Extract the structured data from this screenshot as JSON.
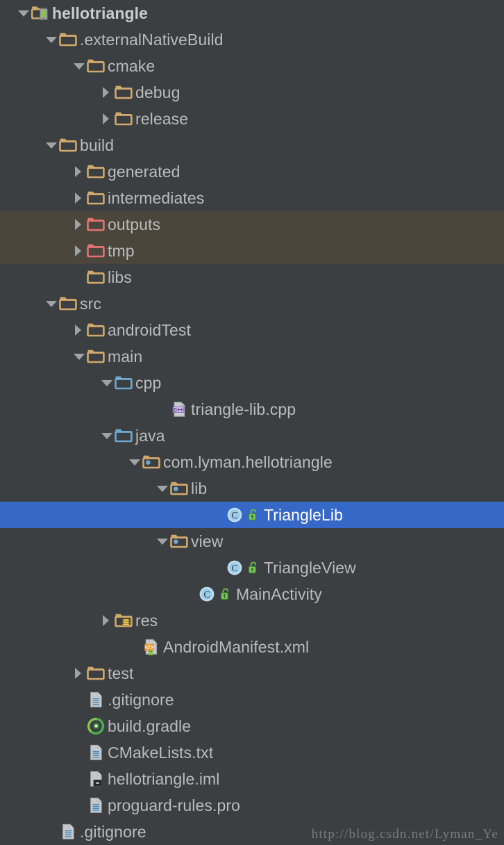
{
  "theme": {
    "background": "#3c3f41",
    "text": "#bbbbbb",
    "selected_background": "#3668c8",
    "selected_text": "#ffffff",
    "highlight_background": "#4a463c",
    "folder_tan": "#d0a96c",
    "folder_red": "#e57373",
    "folder_blue": "#6fa8d0",
    "arrow": "#a0a3a5"
  },
  "watermark": "http://blog.csdn.net/Lyman_Ye",
  "tree": {
    "name": "project-tree",
    "rows": [
      {
        "label": "hellotriangle",
        "icon": "module-android-icon",
        "twisty": "down",
        "depth": 0,
        "bold": true,
        "state": "normal"
      },
      {
        "label": ".externalNativeBuild",
        "icon": "folder-tan-icon",
        "twisty": "down",
        "depth": 1,
        "bold": false,
        "state": "normal"
      },
      {
        "label": "cmake",
        "icon": "folder-tan-icon",
        "twisty": "down",
        "depth": 2,
        "bold": false,
        "state": "normal"
      },
      {
        "label": "debug",
        "icon": "folder-tan-icon",
        "twisty": "right",
        "depth": 3,
        "bold": false,
        "state": "normal"
      },
      {
        "label": "release",
        "icon": "folder-tan-icon",
        "twisty": "right",
        "depth": 3,
        "bold": false,
        "state": "normal"
      },
      {
        "label": "build",
        "icon": "folder-tan-icon",
        "twisty": "down",
        "depth": 1,
        "bold": false,
        "state": "normal"
      },
      {
        "label": "generated",
        "icon": "folder-tan-icon",
        "twisty": "right",
        "depth": 2,
        "bold": false,
        "state": "normal"
      },
      {
        "label": "intermediates",
        "icon": "folder-tan-icon",
        "twisty": "right",
        "depth": 2,
        "bold": false,
        "state": "normal"
      },
      {
        "label": "outputs",
        "icon": "folder-red-icon",
        "twisty": "right",
        "depth": 2,
        "bold": false,
        "state": "highlight"
      },
      {
        "label": "tmp",
        "icon": "folder-red-icon",
        "twisty": "right",
        "depth": 2,
        "bold": false,
        "state": "highlight"
      },
      {
        "label": "libs",
        "icon": "folder-tan-icon",
        "twisty": "none",
        "depth": 2,
        "bold": false,
        "state": "normal"
      },
      {
        "label": "src",
        "icon": "folder-tan-icon",
        "twisty": "down",
        "depth": 1,
        "bold": false,
        "state": "normal"
      },
      {
        "label": "androidTest",
        "icon": "folder-tan-icon",
        "twisty": "right",
        "depth": 2,
        "bold": false,
        "state": "normal"
      },
      {
        "label": "main",
        "icon": "folder-tan-icon",
        "twisty": "down",
        "depth": 2,
        "bold": false,
        "state": "normal"
      },
      {
        "label": "cpp",
        "icon": "folder-blue-icon",
        "twisty": "down",
        "depth": 3,
        "bold": false,
        "state": "normal"
      },
      {
        "label": "triangle-lib.cpp",
        "icon": "file-cpp-icon",
        "twisty": "none",
        "depth": 5,
        "bold": false,
        "state": "normal"
      },
      {
        "label": "java",
        "icon": "folder-blue-icon",
        "twisty": "down",
        "depth": 3,
        "bold": false,
        "state": "normal"
      },
      {
        "label": "com.lyman.hellotriangle",
        "icon": "folder-package-icon",
        "twisty": "down",
        "depth": 4,
        "bold": false,
        "state": "normal"
      },
      {
        "label": "lib",
        "icon": "folder-package-icon",
        "twisty": "down",
        "depth": 5,
        "bold": false,
        "state": "normal"
      },
      {
        "label": "TriangleLib",
        "icon": "class-icon",
        "twisty": "none",
        "depth": 7,
        "bold": false,
        "state": "selected",
        "badge": "unlock-icon"
      },
      {
        "label": "view",
        "icon": "folder-package-icon",
        "twisty": "down",
        "depth": 5,
        "bold": false,
        "state": "normal"
      },
      {
        "label": "TriangleView",
        "icon": "class-icon",
        "twisty": "none",
        "depth": 7,
        "bold": false,
        "state": "normal",
        "badge": "unlock-icon"
      },
      {
        "label": "MainActivity",
        "icon": "class-icon",
        "twisty": "none",
        "depth": 6,
        "bold": false,
        "state": "normal",
        "badge": "unlock-icon"
      },
      {
        "label": "res",
        "icon": "folder-res-icon",
        "twisty": "right",
        "depth": 3,
        "bold": false,
        "state": "normal"
      },
      {
        "label": "AndroidManifest.xml",
        "icon": "file-manifest-icon",
        "twisty": "none",
        "depth": 4,
        "bold": false,
        "state": "normal"
      },
      {
        "label": "test",
        "icon": "folder-tan-icon",
        "twisty": "right",
        "depth": 2,
        "bold": false,
        "state": "normal"
      },
      {
        "label": ".gitignore",
        "icon": "file-text-icon",
        "twisty": "none",
        "depth": 2,
        "bold": false,
        "state": "normal"
      },
      {
        "label": "build.gradle",
        "icon": "file-gradle-icon",
        "twisty": "none",
        "depth": 2,
        "bold": false,
        "state": "normal"
      },
      {
        "label": "CMakeLists.txt",
        "icon": "file-text-icon",
        "twisty": "none",
        "depth": 2,
        "bold": false,
        "state": "normal"
      },
      {
        "label": "hellotriangle.iml",
        "icon": "file-iml-icon",
        "twisty": "none",
        "depth": 2,
        "bold": false,
        "state": "normal"
      },
      {
        "label": "proguard-rules.pro",
        "icon": "file-text-icon",
        "twisty": "none",
        "depth": 2,
        "bold": false,
        "state": "normal"
      },
      {
        "label": ".gitignore",
        "icon": "file-text-icon",
        "twisty": "none",
        "depth": 1,
        "bold": false,
        "state": "normal"
      }
    ]
  }
}
